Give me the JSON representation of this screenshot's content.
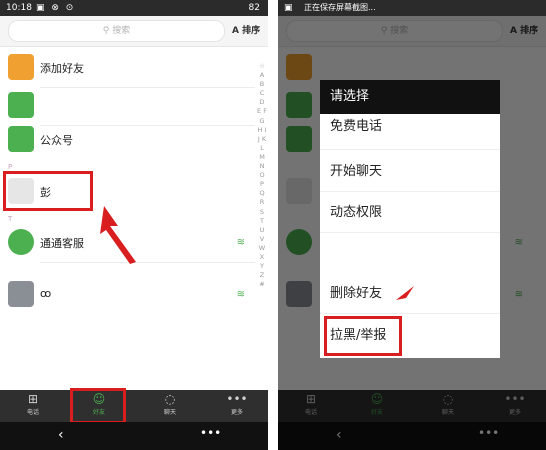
{
  "left": {
    "status": {
      "time": "10:18",
      "icons": "▣ ⊗ ⊙",
      "right": "82"
    },
    "search_placeholder": "搜索",
    "sort_label": "排序",
    "sort_icon_text": "A",
    "rows": {
      "add_friend": "添加好友",
      "public_account": "公众号",
      "peng": "彭",
      "service": "通通客服",
      "contact_o": "ꝏ"
    },
    "sections": {
      "p": "P",
      "t": "T"
    },
    "index_letters": "☆ A B C D E F G H I J K L M N O P Q R S T U V W X Y Z #",
    "nav": {
      "phone": "电话",
      "friends": "好友",
      "chat": "聊天",
      "more": "更多"
    }
  },
  "right": {
    "status_caption": "正在保存屏幕截图...",
    "search_placeholder": "搜索",
    "sort_label": "排序",
    "menu": {
      "title": "请选择",
      "items": [
        "免费电话",
        "开始聊天",
        "动态权限",
        "删除好友",
        "拉黑/举报"
      ]
    },
    "nav": {
      "phone": "电话",
      "friends": "好友",
      "chat": "聊天",
      "more": "更多"
    }
  },
  "colors": {
    "accent_green": "#4caf50",
    "highlight_red": "#d81e1e",
    "add_friend_orange": "#f0a030"
  }
}
